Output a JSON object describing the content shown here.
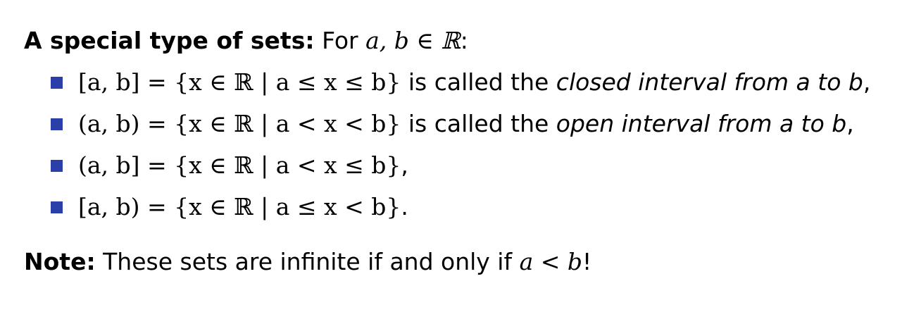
{
  "heading": {
    "label": "A special type of sets:",
    "rest": "For ",
    "math": "a, b ∈ ℝ",
    "colon": ":"
  },
  "bullet_color": "#2a3fa8",
  "items": [
    {
      "set": "[a, b] = {x ∈ ℝ | a ≤ x ≤ b}",
      "text": " is called the ",
      "name": "closed interval from a to b",
      "end": ","
    },
    {
      "set": "(a, b) = {x ∈ ℝ | a < x < b}",
      "text": " is called the ",
      "name": "open interval from a to b",
      "end": ","
    },
    {
      "set": "(a, b] = {x ∈ ℝ | a < x ≤ b}",
      "text": "",
      "name": "",
      "end": ","
    },
    {
      "set": "[a, b) = {x ∈ ℝ | a ≤ x < b}",
      "text": "",
      "name": "",
      "end": "."
    }
  ],
  "note": {
    "label": "Note:",
    "text": " These sets are infinite if and only if ",
    "math": "a < b",
    "end": "!"
  }
}
